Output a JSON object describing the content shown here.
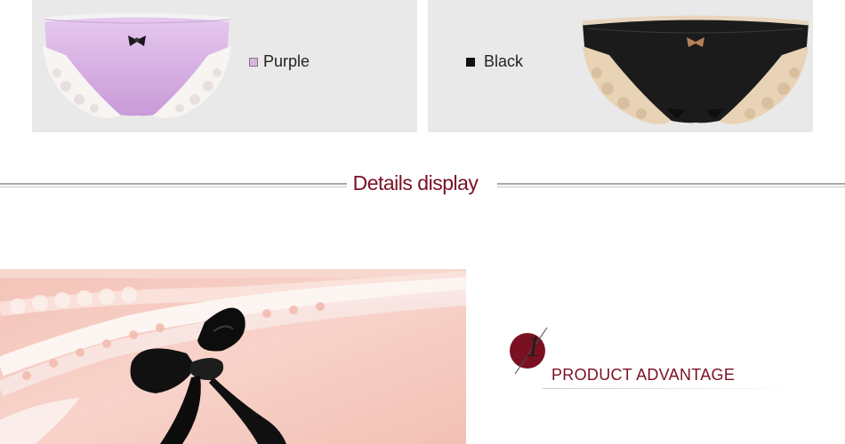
{
  "swatches": {
    "purple": {
      "label": "Purple",
      "color": "#d6b8d8"
    },
    "black": {
      "label": "Black",
      "color": "#111111"
    }
  },
  "section": {
    "title": "Details display"
  },
  "advantage": {
    "number": "1",
    "label": "PRODUCT ADVANTAGE",
    "accent": "#7a1123"
  },
  "colors": {
    "panel_bg": "#e9e9ea",
    "title_color": "#7a1123"
  }
}
